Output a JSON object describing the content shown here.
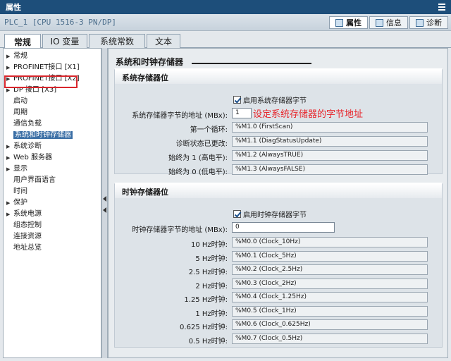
{
  "window": {
    "title": "属性"
  },
  "device": {
    "name": "PLC_1 [CPU 1516-3 PN/DP]"
  },
  "toptabs": [
    {
      "label": "属性",
      "active": true
    },
    {
      "label": "信息",
      "active": false
    },
    {
      "label": "诊断",
      "active": false
    }
  ],
  "subtabs": [
    {
      "label": "常规",
      "active": true
    },
    {
      "label": "IO 变量",
      "active": false
    },
    {
      "label": "系统常数",
      "active": false
    },
    {
      "label": "文本",
      "active": false
    }
  ],
  "nav": [
    {
      "label": "常规",
      "expandable": true,
      "child": false
    },
    {
      "label": "PROFINET接口 [X1]",
      "expandable": true,
      "child": false
    },
    {
      "label": "PROFINET接口 [X2]",
      "expandable": true,
      "child": false
    },
    {
      "label": "DP 接口 [X3]",
      "expandable": true,
      "child": false
    },
    {
      "label": "启动",
      "expandable": false,
      "child": true
    },
    {
      "label": "周期",
      "expandable": false,
      "child": true
    },
    {
      "label": "通信负载",
      "expandable": false,
      "child": true
    },
    {
      "label": "系统和时钟存储器",
      "expandable": false,
      "child": true,
      "selected": true
    },
    {
      "label": "系统诊断",
      "expandable": true,
      "child": false
    },
    {
      "label": "Web 服务器",
      "expandable": true,
      "child": false
    },
    {
      "label": "显示",
      "expandable": true,
      "child": false
    },
    {
      "label": "用户界面语言",
      "expandable": false,
      "child": true
    },
    {
      "label": "时间",
      "expandable": false,
      "child": true
    },
    {
      "label": "保护",
      "expandable": true,
      "child": false
    },
    {
      "label": "系统电源",
      "expandable": true,
      "child": false
    },
    {
      "label": "组态控制",
      "expandable": false,
      "child": true
    },
    {
      "label": "连接资源",
      "expandable": false,
      "child": true
    },
    {
      "label": "地址总览",
      "expandable": false,
      "child": true
    }
  ],
  "main": {
    "section_title": "系统和时钟存储器",
    "system": {
      "header": "系统存储器位",
      "enable_label": "启用系统存储器字节",
      "address_label": "系统存储器字节的地址 (MBx):",
      "address_value": "1",
      "annotation": "设定系统存储器的字节地址",
      "rows": [
        {
          "label": "第一个循环:",
          "value": "%M1.0 (FirstScan)"
        },
        {
          "label": "诊断状态已更改:",
          "value": "%M1.1 (DiagStatusUpdate)"
        },
        {
          "label": "始终为 1 (高电平):",
          "value": "%M1.2 (AlwaysTRUE)"
        },
        {
          "label": "始终为 0 (低电平):",
          "value": "%M1.3 (AlwaysFALSE)"
        }
      ]
    },
    "clock": {
      "header": "时钟存储器位",
      "enable_label": "启用时钟存储器字节",
      "address_label": "时钟存储器字节的地址 (MBx):",
      "address_value": "0",
      "rows": [
        {
          "label": "10 Hz时钟:",
          "value": "%M0.0 (Clock_10Hz)"
        },
        {
          "label": "5 Hz时钟:",
          "value": "%M0.1 (Clock_5Hz)"
        },
        {
          "label": "2.5 Hz时钟:",
          "value": "%M0.2 (Clock_2.5Hz)"
        },
        {
          "label": "2 Hz时钟:",
          "value": "%M0.3 (Clock_2Hz)"
        },
        {
          "label": "1.25 Hz时钟:",
          "value": "%M0.4 (Clock_1.25Hz)"
        },
        {
          "label": "1 Hz时钟:",
          "value": "%M0.5 (Clock_1Hz)"
        },
        {
          "label": "0.625 Hz时钟:",
          "value": "%M0.6 (Clock_0.625Hz)"
        },
        {
          "label": "0.5 Hz时钟:",
          "value": "%M0.7 (Clock_0.5Hz)"
        }
      ]
    }
  }
}
